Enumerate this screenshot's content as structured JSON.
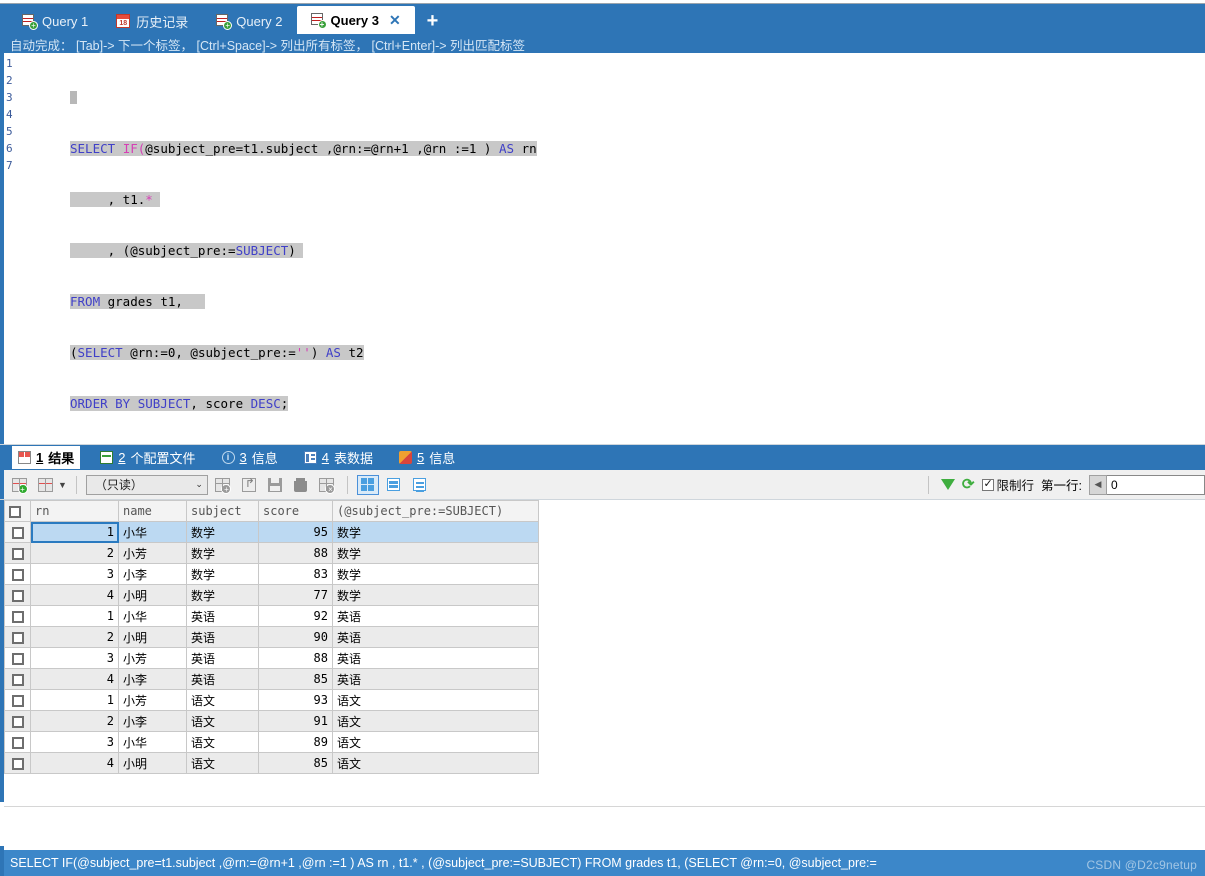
{
  "window": {
    "app": "MySQL Workbench query editor"
  },
  "tabs": {
    "items": [
      {
        "label": "Query 1",
        "icon": "query-grid-icon",
        "active": false,
        "closable": false
      },
      {
        "label": "历史记录",
        "icon": "calendar-18-icon",
        "active": false,
        "closable": false
      },
      {
        "label": "Query 2",
        "icon": "query-grid-icon",
        "active": false,
        "closable": false
      },
      {
        "label": "Query 3",
        "icon": "query-grid-icon",
        "active": true,
        "closable": true
      }
    ],
    "close_glyph": "✕",
    "add_label": "+"
  },
  "hint": {
    "text": "自动完成： [Tab]-> 下一个标签， [Ctrl+Space]-> 列出所有标签， [Ctrl+Enter]-> 列出匹配标签"
  },
  "editor": {
    "line_numbers": [
      "1",
      "2",
      "3",
      "4",
      "5",
      "6",
      "7"
    ],
    "lines": [
      "",
      "SELECT IF(@subject_pre=t1.subject ,@rn:=@rn+1 ,@rn :=1 ) AS rn",
      "     , t1.*",
      "     , (@subject_pre:=SUBJECT)",
      "FROM grades t1,",
      "(SELECT @rn:=0, @subject_pre:='') AS t2",
      "ORDER BY SUBJECT, score DESC;"
    ]
  },
  "result_tabs": {
    "items": [
      {
        "num": "1",
        "label": "结果",
        "icon": "result-grid-icon",
        "active": true
      },
      {
        "num": "2",
        "label": "个配置文件",
        "icon": "profile-icon",
        "active": false
      },
      {
        "num": "3",
        "label": "信息",
        "icon": "info-icon",
        "active": false
      },
      {
        "num": "4",
        "label": "表数据",
        "icon": "table-data-icon",
        "active": false
      },
      {
        "num": "5",
        "label": "信息",
        "icon": "pie-chart-icon",
        "active": false
      }
    ]
  },
  "grid_toolbar": {
    "edit_icon": "edit-row-icon",
    "delete_icon": "delete-row-icon",
    "caret": "▼",
    "mode_value": "（只读）",
    "mode_caret": "⌄",
    "buttons": [
      {
        "name": "insert-row-button",
        "icon": "insert-row-icon"
      },
      {
        "name": "export-import-button",
        "icon": "export-import-icon"
      },
      {
        "name": "save-button",
        "icon": "floppy-save-icon"
      },
      {
        "name": "delete-button",
        "icon": "trash-icon"
      },
      {
        "name": "revert-button",
        "icon": "revert-icon"
      }
    ],
    "view_buttons": [
      {
        "name": "grid-view-button",
        "icon": "grid-view-icon",
        "active": true
      },
      {
        "name": "form-view-button",
        "icon": "form-view-icon",
        "active": false
      },
      {
        "name": "field-view-button",
        "icon": "field-view-icon",
        "active": false
      }
    ],
    "filter_icon": "filter-funnel-icon",
    "refresh_icon": "refresh-icon",
    "limit_checkbox_label": "限制行",
    "limit_checked": true,
    "first_row_label": "第一行:",
    "first_row_value": "0",
    "spin_left_glyph": "◀"
  },
  "grid": {
    "columns": [
      "rn",
      "name",
      "subject",
      "score",
      "(@subject_pre:=SUBJECT)"
    ],
    "rows": [
      {
        "rn": "1",
        "name": "小华",
        "subject": "数学",
        "score": "95",
        "expr": "数学",
        "selected": true
      },
      {
        "rn": "2",
        "name": "小芳",
        "subject": "数学",
        "score": "88",
        "expr": "数学",
        "selected": false
      },
      {
        "rn": "3",
        "name": "小李",
        "subject": "数学",
        "score": "83",
        "expr": "数学",
        "selected": false
      },
      {
        "rn": "4",
        "name": "小明",
        "subject": "数学",
        "score": "77",
        "expr": "数学",
        "selected": false
      },
      {
        "rn": "1",
        "name": "小华",
        "subject": "英语",
        "score": "92",
        "expr": "英语",
        "selected": false
      },
      {
        "rn": "2",
        "name": "小明",
        "subject": "英语",
        "score": "90",
        "expr": "英语",
        "selected": false
      },
      {
        "rn": "3",
        "name": "小芳",
        "subject": "英语",
        "score": "88",
        "expr": "英语",
        "selected": false
      },
      {
        "rn": "4",
        "name": "小李",
        "subject": "英语",
        "score": "85",
        "expr": "英语",
        "selected": false
      },
      {
        "rn": "1",
        "name": "小芳",
        "subject": "语文",
        "score": "93",
        "expr": "语文",
        "selected": false
      },
      {
        "rn": "2",
        "name": "小李",
        "subject": "语文",
        "score": "91",
        "expr": "语文",
        "selected": false
      },
      {
        "rn": "3",
        "name": "小华",
        "subject": "语文",
        "score": "89",
        "expr": "语文",
        "selected": false
      },
      {
        "rn": "4",
        "name": "小明",
        "subject": "语文",
        "score": "85",
        "expr": "语文",
        "selected": false
      }
    ]
  },
  "status": {
    "text": "SELECT IF(@subject_pre=t1.subject ,@rn:=@rn+1 ,@rn :=1 ) AS rn , t1.* , (@subject_pre:=SUBJECT) FROM grades t1, (SELECT @rn:=0, @subject_pre:=",
    "watermark": "CSDN @D2c9netup"
  },
  "colors": {
    "accent_blue": "#2e75b6",
    "status_blue": "#3c87c9",
    "selection_gray": "#c8c8c8",
    "keyword_blue": "#4040c8",
    "function_magenta": "#d63fb5",
    "row_selected": "#bcd9f2",
    "header_rn": "#3e9bdc"
  }
}
